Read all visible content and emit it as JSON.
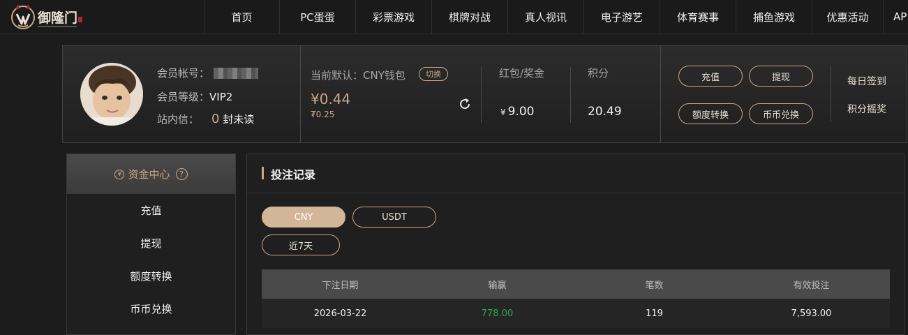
{
  "brand": {
    "name": "御隆门",
    "accent": "#c9a98a",
    "seal_color": "#b3262d"
  },
  "nav": {
    "items": [
      {
        "label": "首页"
      },
      {
        "label": "PC蛋蛋"
      },
      {
        "label": "彩票游戏"
      },
      {
        "label": "棋牌对战"
      },
      {
        "label": "真人视讯"
      },
      {
        "label": "电子游艺"
      },
      {
        "label": "体育赛事"
      },
      {
        "label": "捕鱼游戏"
      },
      {
        "label": "优惠活动"
      },
      {
        "label": "AP"
      }
    ]
  },
  "profile": {
    "account_label": "会员帐号：",
    "level_label": "会员等级：",
    "level_value": "VIP2",
    "inbox_label": "站内信：",
    "unread_count": "0",
    "unread_suffix": "封未读"
  },
  "wallet": {
    "default_label": "当前默认：CNY钱包",
    "switch_label": "切换",
    "balance": "¥0.44",
    "balance_sub": "₮0.25",
    "redpacket_label": "红包/奖金",
    "redpacket_currency": "¥",
    "redpacket_value": "9.00",
    "points_label": "积分",
    "points_value": "20.49"
  },
  "actions": {
    "deposit": "充值",
    "withdraw": "提现",
    "transfer": "额度转换",
    "exchange": "币币兑换",
    "checkin": "每日签到",
    "points_lottery": "积分摇奖"
  },
  "sidebar": {
    "title": "资金中心",
    "help_icon": "?",
    "coin_icon": "¥",
    "items": [
      {
        "label": "充值"
      },
      {
        "label": "提现"
      },
      {
        "label": "额度转换"
      },
      {
        "label": "币币兑换"
      }
    ]
  },
  "main": {
    "title": "投注记录",
    "currency_tabs": [
      {
        "label": "CNY",
        "active": true
      },
      {
        "label": "USDT",
        "active": false
      }
    ],
    "range_tab": "近7天",
    "table": {
      "headers": [
        "下注日期",
        "输赢",
        "笔数",
        "有效投注"
      ],
      "rows": [
        {
          "date": "2026-03-22",
          "winloss": "778.00",
          "count": "119",
          "valid_bet": "7,593.00"
        }
      ]
    }
  }
}
